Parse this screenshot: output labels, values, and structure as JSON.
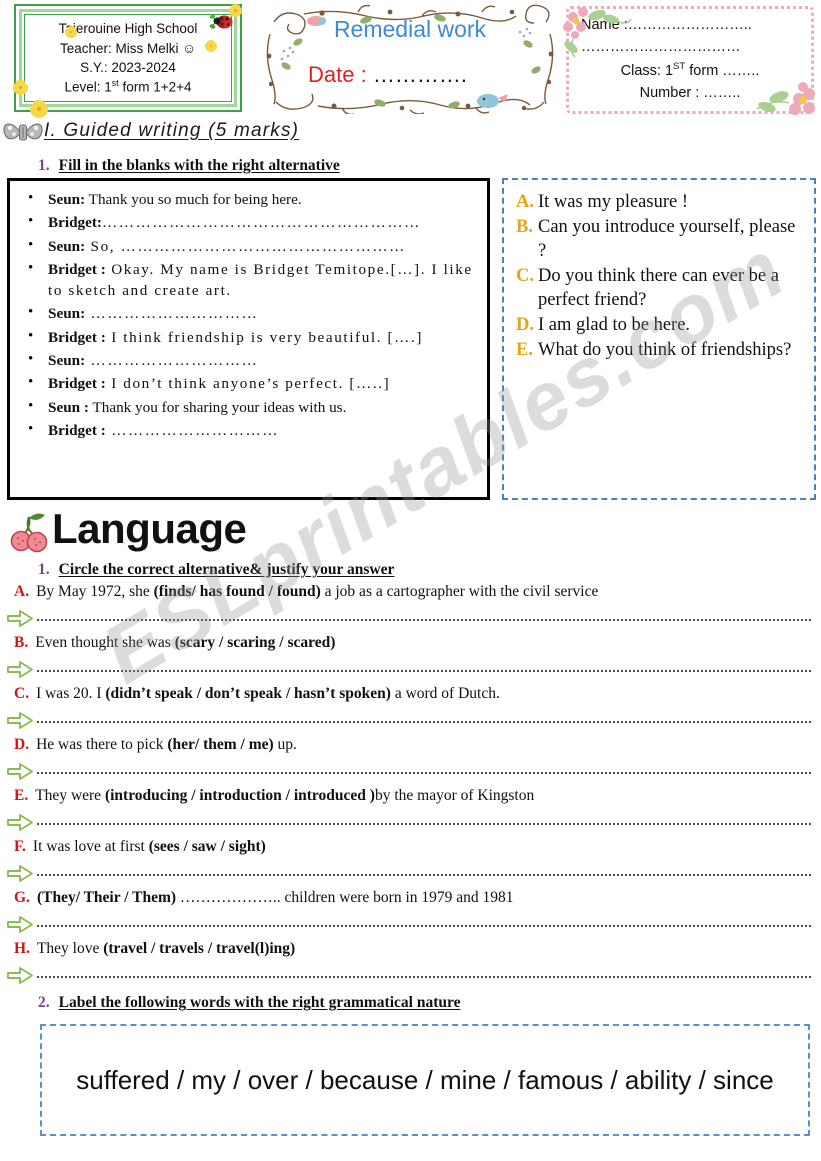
{
  "watermark": "ESLprintables.com",
  "header": {
    "school_box": {
      "line1": "Tajerouine High School",
      "line2": "Teacher: Miss Melki ☺",
      "line3": "S.Y.: 2023-2024",
      "level_prefix": "Level: 1",
      "level_sup": "st",
      "level_suffix": " form 1+2+4",
      "border_color": "#3aa34a",
      "icons": [
        "ladybug-icon",
        "flower-icon"
      ]
    },
    "remedial_box": {
      "title": "Remedial work",
      "title_color": "#3c8ad9",
      "date_label": "Date :",
      "date_label_color": "#e31f1f",
      "date_dots": "………….",
      "decoration": "vine-swirl-frame"
    },
    "name_box": {
      "name_label": "Name :",
      "name_dots": "……………………..",
      "name_dots_line2": "……………………………",
      "class_prefix": "Class: 1",
      "class_sup": "ST",
      "class_suffix": " form ……..",
      "number_label": "Number : ……..",
      "border_color": "#f2a8bb"
    }
  },
  "section_one": {
    "heading": "I. Guided writing (5 marks)",
    "icon": "bow-icon",
    "task_number": "1.",
    "task_number_color": "#7b3f9d",
    "task_text": "Fill in the blanks with the right alternative",
    "dialogue": [
      {
        "speaker": "Seun:",
        "text": " Thank you so much for being here."
      },
      {
        "speaker": "Bridget:",
        "text": "…………………………………………………"
      },
      {
        "speaker": "Seun:",
        "text": " So, ……………………………………………"
      },
      {
        "speaker": "Bridget :",
        "text": " Okay. My name is Bridget Temitope.[…]. I like to sketch and create art."
      },
      {
        "speaker": "Seun:",
        "text": " …………………………"
      },
      {
        "speaker": "Bridget :",
        "text": " I think friendship is very beautiful. [….]"
      },
      {
        "speaker": "Seun:",
        "text": " …………………………"
      },
      {
        "speaker": "Bridget :",
        "text": " I don’t think anyone’s perfect. […..]"
      },
      {
        "speaker": "Seun :",
        "text": " Thank you for sharing your ideas with us."
      },
      {
        "speaker": "Bridget :",
        "text": " …………………………"
      }
    ],
    "options_letter_color": "#e8a317",
    "options_border_color": "#4a7fc1",
    "options": [
      {
        "letter": "A.",
        "text": "It was my pleasure !"
      },
      {
        "letter": "B.",
        "text": "Can you introduce yourself, please ?"
      },
      {
        "letter": "C.",
        "text": "Do you think there can ever be a perfect friend?"
      },
      {
        "letter": "D.",
        "text": "I am glad to be here."
      },
      {
        "letter": "E.",
        "text": "What do you think of friendships?"
      }
    ]
  },
  "section_two": {
    "heading": "Language",
    "icon": "cherries-icon",
    "task_number": "1.",
    "task_number_color": "#7b3f9d",
    "task_text": "Circle the correct alternative& justify your answer",
    "letter_color": "#d41414",
    "arrow_icon": "green-arrow-icon",
    "items": [
      {
        "letter": "A.",
        "pre": "By May 1972, she ",
        "choices": "(finds/ has found / found)",
        "post": " a job as a cartographer with the civil service"
      },
      {
        "letter": "B.",
        "pre": "Even thought she was ",
        "choices": "(scary / scaring / scared)",
        "post": ""
      },
      {
        "letter": "C.",
        "pre": "I was 20. I ",
        "choices": "(didn’t speak / don’t speak / hasn’t spoken)",
        "post": " a word of Dutch."
      },
      {
        "letter": "D.",
        "pre": "He was there to pick ",
        "choices": "(her/ them / me)",
        "post": " up."
      },
      {
        "letter": "E.",
        "pre": "They were ",
        "choices": "(introducing /  introduction / introduced )",
        "post": "by the mayor of Kingston"
      },
      {
        "letter": "F.",
        "pre": "It was love at first ",
        "choices": "(sees / saw / sight)",
        "post": ""
      },
      {
        "letter": "G.",
        "pre": "",
        "choices": "(They/ Their / Them)",
        "post": "  ………………..   children were born in 1979 and 1981"
      },
      {
        "letter": "H.",
        "pre": "They love ",
        "choices": "(travel / travels / travel(l)ing)",
        "post": ""
      }
    ],
    "task2_number": "2.",
    "task2_text": "Label the following words with the right grammatical nature",
    "wordbank": "suffered / my / over /  because / mine / famous / ability / since",
    "wordbank_border_color": "#5d8fce"
  }
}
